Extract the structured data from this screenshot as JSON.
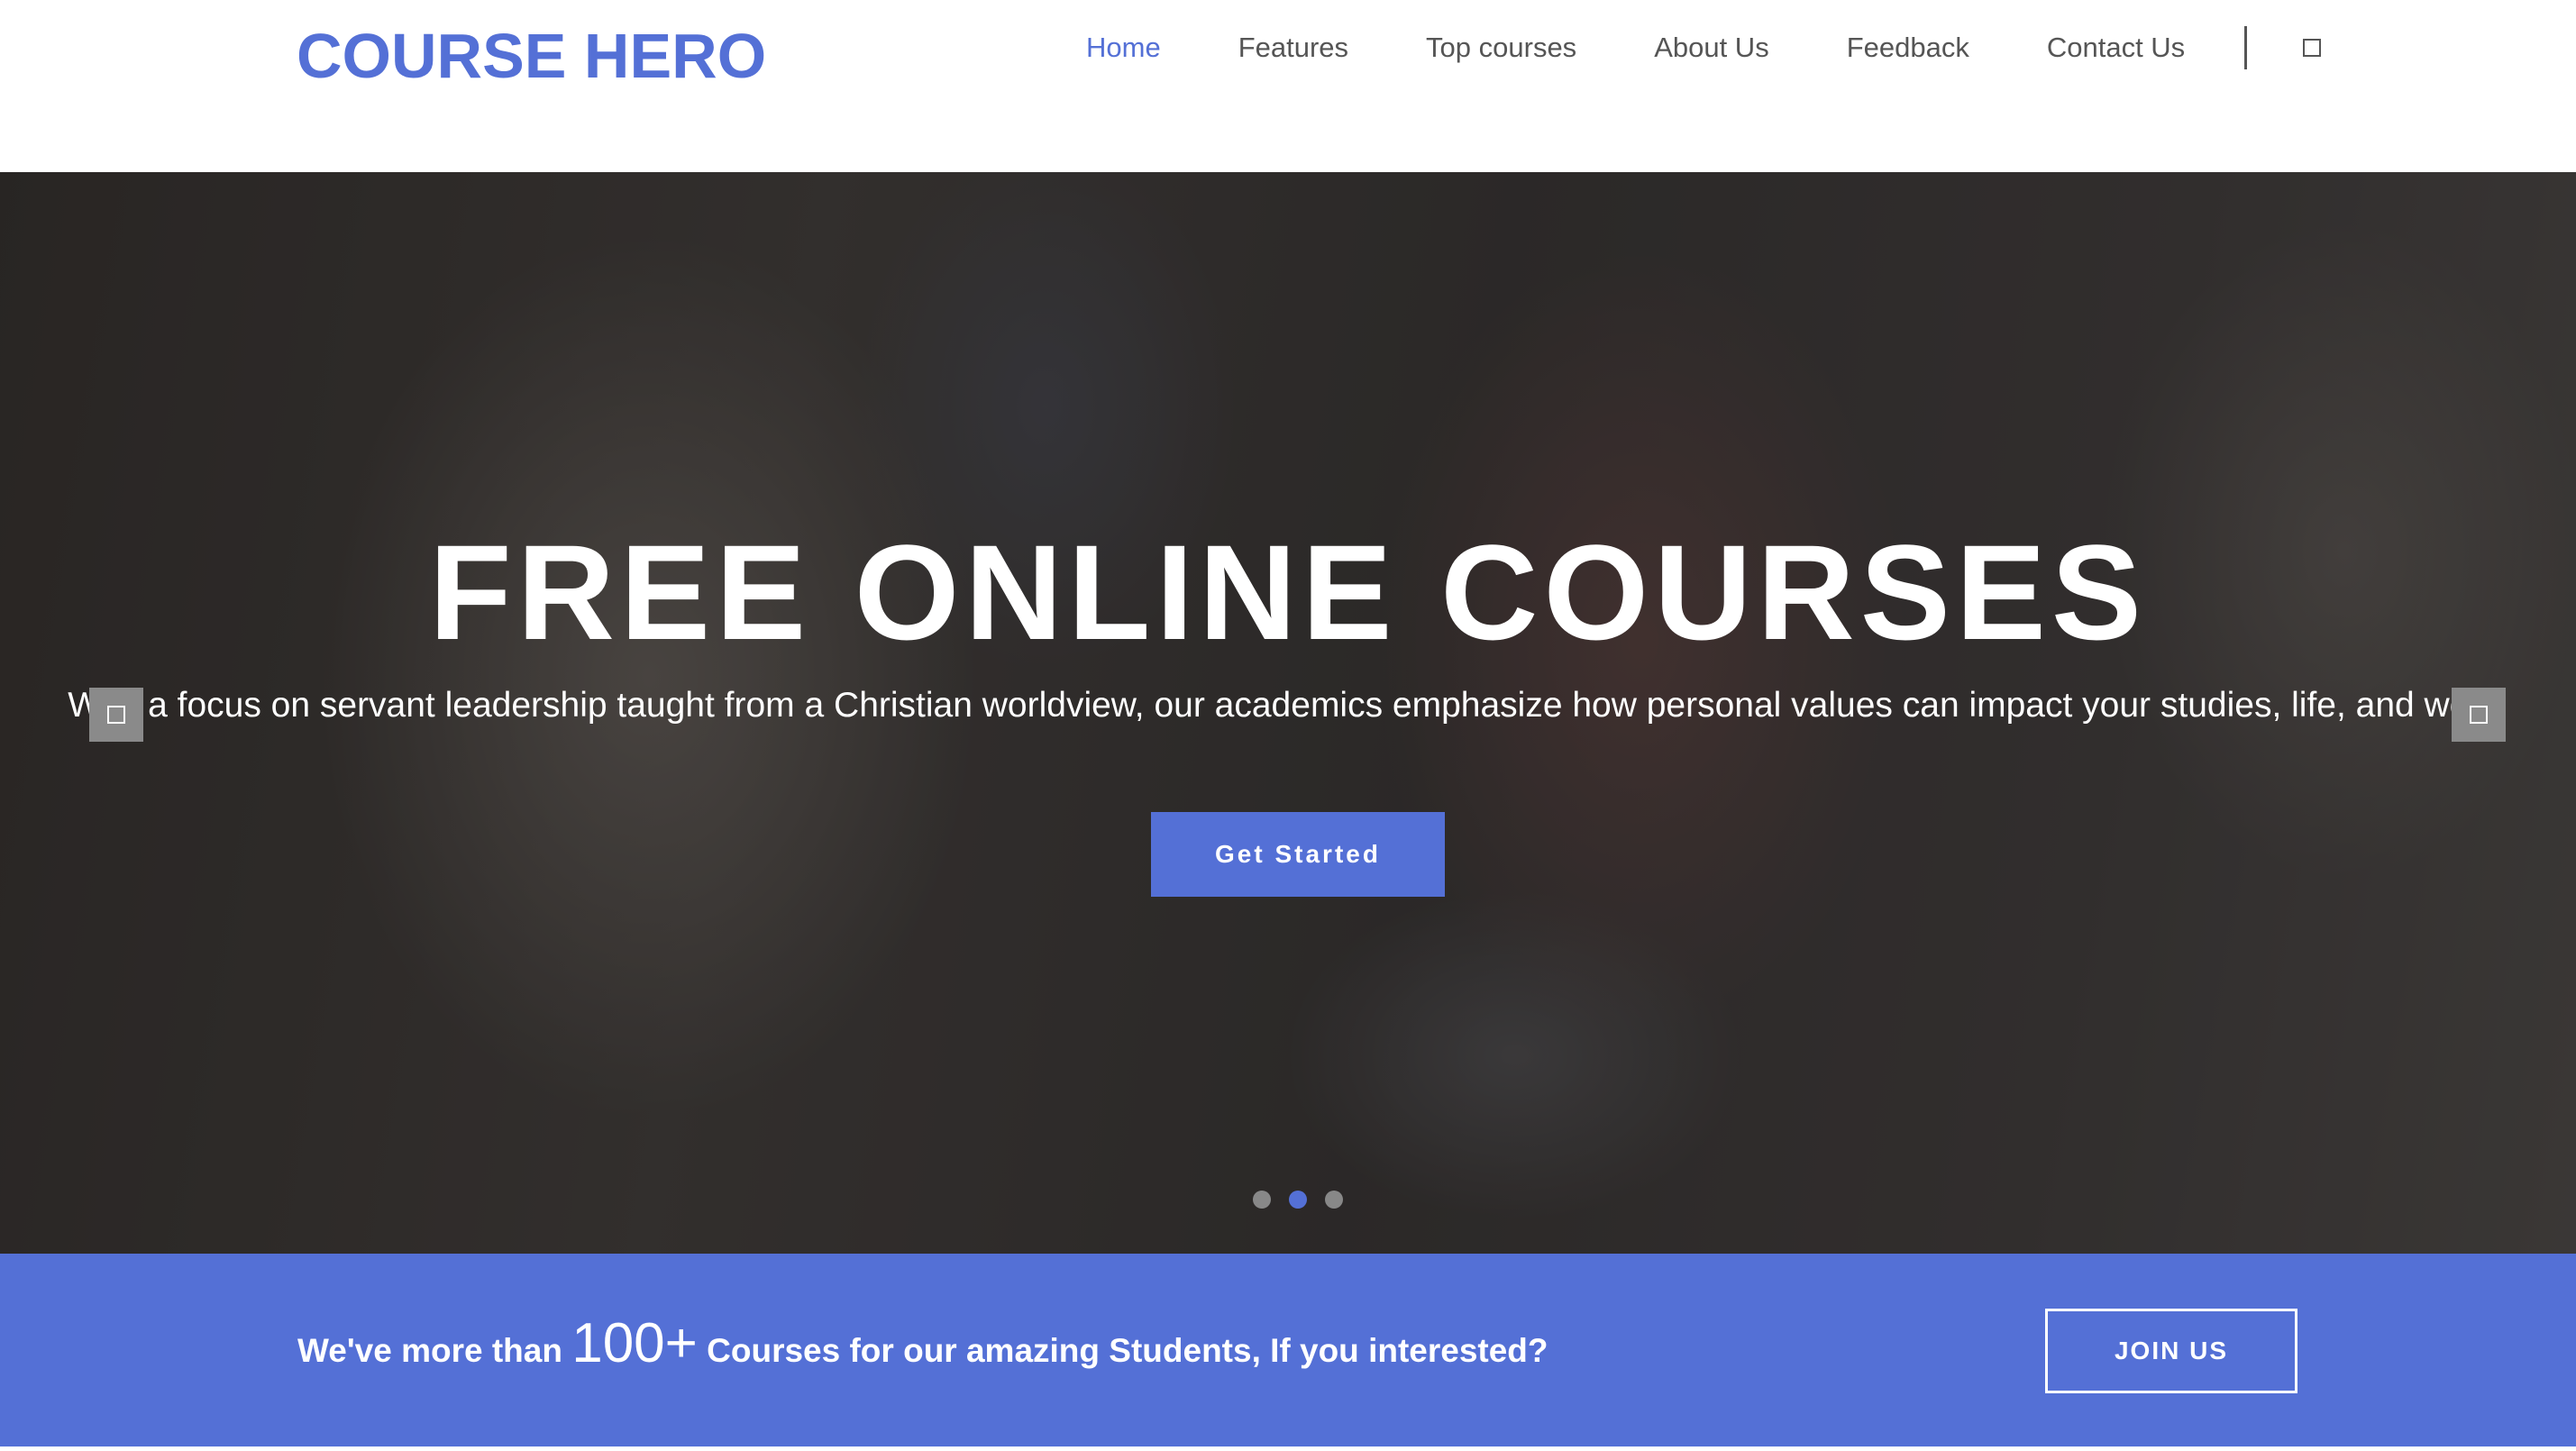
{
  "header": {
    "logo": "COURSE HERO",
    "nav": [
      {
        "label": "Home",
        "active": true
      },
      {
        "label": "Features",
        "active": false
      },
      {
        "label": "Top courses",
        "active": false
      },
      {
        "label": "About Us",
        "active": false
      },
      {
        "label": "Feedback",
        "active": false
      },
      {
        "label": "Contact Us",
        "active": false
      }
    ],
    "search_icon": "search-icon"
  },
  "hero": {
    "title": "FREE ONLINE COURSES",
    "subtitle": "With a focus on servant leadership taught from a Christian worldview, our academics emphasize how personal values can impact your studies, life, and work.",
    "cta_label": "Get Started",
    "prev_icon": "chevron-left-icon",
    "next_icon": "chevron-right-icon",
    "slide_count": 3,
    "active_slide": 2
  },
  "promo": {
    "text_before": "We've more than",
    "highlight": "100+",
    "text_after": "Courses for our amazing Students, If you interested?",
    "button_label": "JOIN US"
  },
  "colors": {
    "accent": "#5470d6",
    "nav_text": "#555555",
    "white": "#ffffff"
  }
}
